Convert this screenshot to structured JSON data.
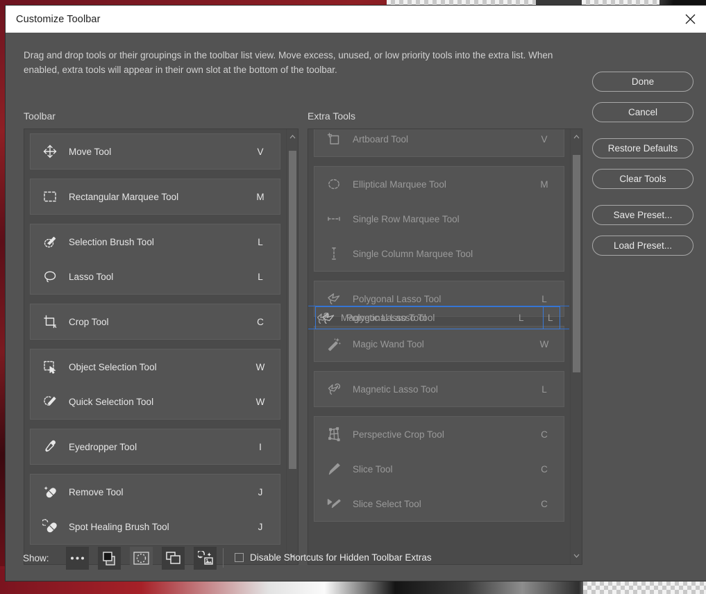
{
  "window": {
    "title": "Customize Toolbar",
    "close_icon": "close-icon"
  },
  "intro_text": "Drag and drop tools or their groupings in the toolbar list view. Move excess, unused, or low priority tools into the extra list. When enabled, extra tools will appear in their own slot at the bottom of the toolbar.",
  "columns": {
    "toolbar_label": "Toolbar",
    "extra_label": "Extra Tools"
  },
  "toolbar_groups": [
    {
      "tools": [
        {
          "name": "Move Tool",
          "key": "V",
          "icon": "move-tool-icon"
        }
      ]
    },
    {
      "tools": [
        {
          "name": "Rectangular Marquee Tool",
          "key": "M",
          "icon": "rectangular-marquee-tool-icon"
        }
      ]
    },
    {
      "tools": [
        {
          "name": "Selection Brush Tool",
          "key": "L",
          "icon": "selection-brush-tool-icon"
        },
        {
          "name": "Lasso Tool",
          "key": "L",
          "icon": "lasso-tool-icon"
        }
      ]
    },
    {
      "tools": [
        {
          "name": "Crop Tool",
          "key": "C",
          "icon": "crop-tool-icon"
        }
      ]
    },
    {
      "tools": [
        {
          "name": "Object Selection Tool",
          "key": "W",
          "icon": "object-selection-tool-icon"
        },
        {
          "name": "Quick Selection Tool",
          "key": "W",
          "icon": "quick-selection-tool-icon"
        }
      ]
    },
    {
      "tools": [
        {
          "name": "Eyedropper Tool",
          "key": "I",
          "icon": "eyedropper-tool-icon"
        }
      ]
    },
    {
      "tools": [
        {
          "name": "Remove Tool",
          "key": "J",
          "icon": "remove-tool-icon"
        },
        {
          "name": "Spot Healing Brush Tool",
          "key": "J",
          "icon": "spot-healing-brush-tool-icon"
        }
      ]
    }
  ],
  "extra_groups": [
    {
      "tools": [
        {
          "name": "Artboard Tool",
          "key": "V",
          "icon": "artboard-tool-icon"
        }
      ]
    },
    {
      "tools": [
        {
          "name": "Elliptical Marquee Tool",
          "key": "M",
          "icon": "elliptical-marquee-tool-icon"
        },
        {
          "name": "Single Row Marquee Tool",
          "key": "",
          "icon": "single-row-marquee-tool-icon"
        },
        {
          "name": "Single Column Marquee Tool",
          "key": "",
          "icon": "single-column-marquee-tool-icon"
        }
      ]
    },
    {
      "tools": [
        {
          "name": "Polygonal Lasso Tool",
          "key": "L",
          "icon": "polygonal-lasso-tool-icon"
        }
      ]
    },
    {
      "tools": [
        {
          "name": "Magic Wand Tool",
          "key": "W",
          "icon": "magic-wand-tool-icon"
        }
      ]
    },
    {
      "tools": [
        {
          "name": "Magnetic Lasso Tool",
          "key": "L",
          "icon": "magnetic-lasso-tool-icon"
        }
      ]
    },
    {
      "tools": [
        {
          "name": "Perspective Crop Tool",
          "key": "C",
          "icon": "perspective-crop-tool-icon"
        },
        {
          "name": "Slice Tool",
          "key": "C",
          "icon": "slice-tool-icon"
        },
        {
          "name": "Slice Select Tool",
          "key": "C",
          "icon": "slice-select-tool-icon"
        }
      ]
    }
  ],
  "drag": {
    "dragged_tool_name": "Polygonal Lasso Tool",
    "dragged_tool_key": "L",
    "target_tool_name": "Magnetic Lasso Tool",
    "target_tool_key": "L",
    "highlight_color": "#3a7ad9"
  },
  "buttons": {
    "done": "Done",
    "cancel": "Cancel",
    "restore_defaults": "Restore Defaults",
    "clear_tools": "Clear Tools",
    "save_preset": "Save Preset...",
    "load_preset": "Load Preset..."
  },
  "footer": {
    "show_label": "Show:",
    "icons": [
      "ellipsis-icon",
      "foreground-background-color-icon",
      "quick-mask-icon",
      "screen-mode-icon",
      "edit-toolbar-icon"
    ],
    "checkbox_label": "Disable Shortcuts for Hidden Toolbar Extras",
    "checkbox_checked": false
  },
  "scrollbars": {
    "toolbar": {
      "up_arrow": "chevron-up-icon",
      "down_arrow": "chevron-down-icon",
      "thumb_top_pct": 2,
      "thumb_height_pct": 38
    },
    "extra": {
      "up_arrow": "chevron-up-icon",
      "down_arrow": "chevron-down-icon",
      "thumb_top_pct": 3,
      "thumb_height_pct": 26
    }
  }
}
